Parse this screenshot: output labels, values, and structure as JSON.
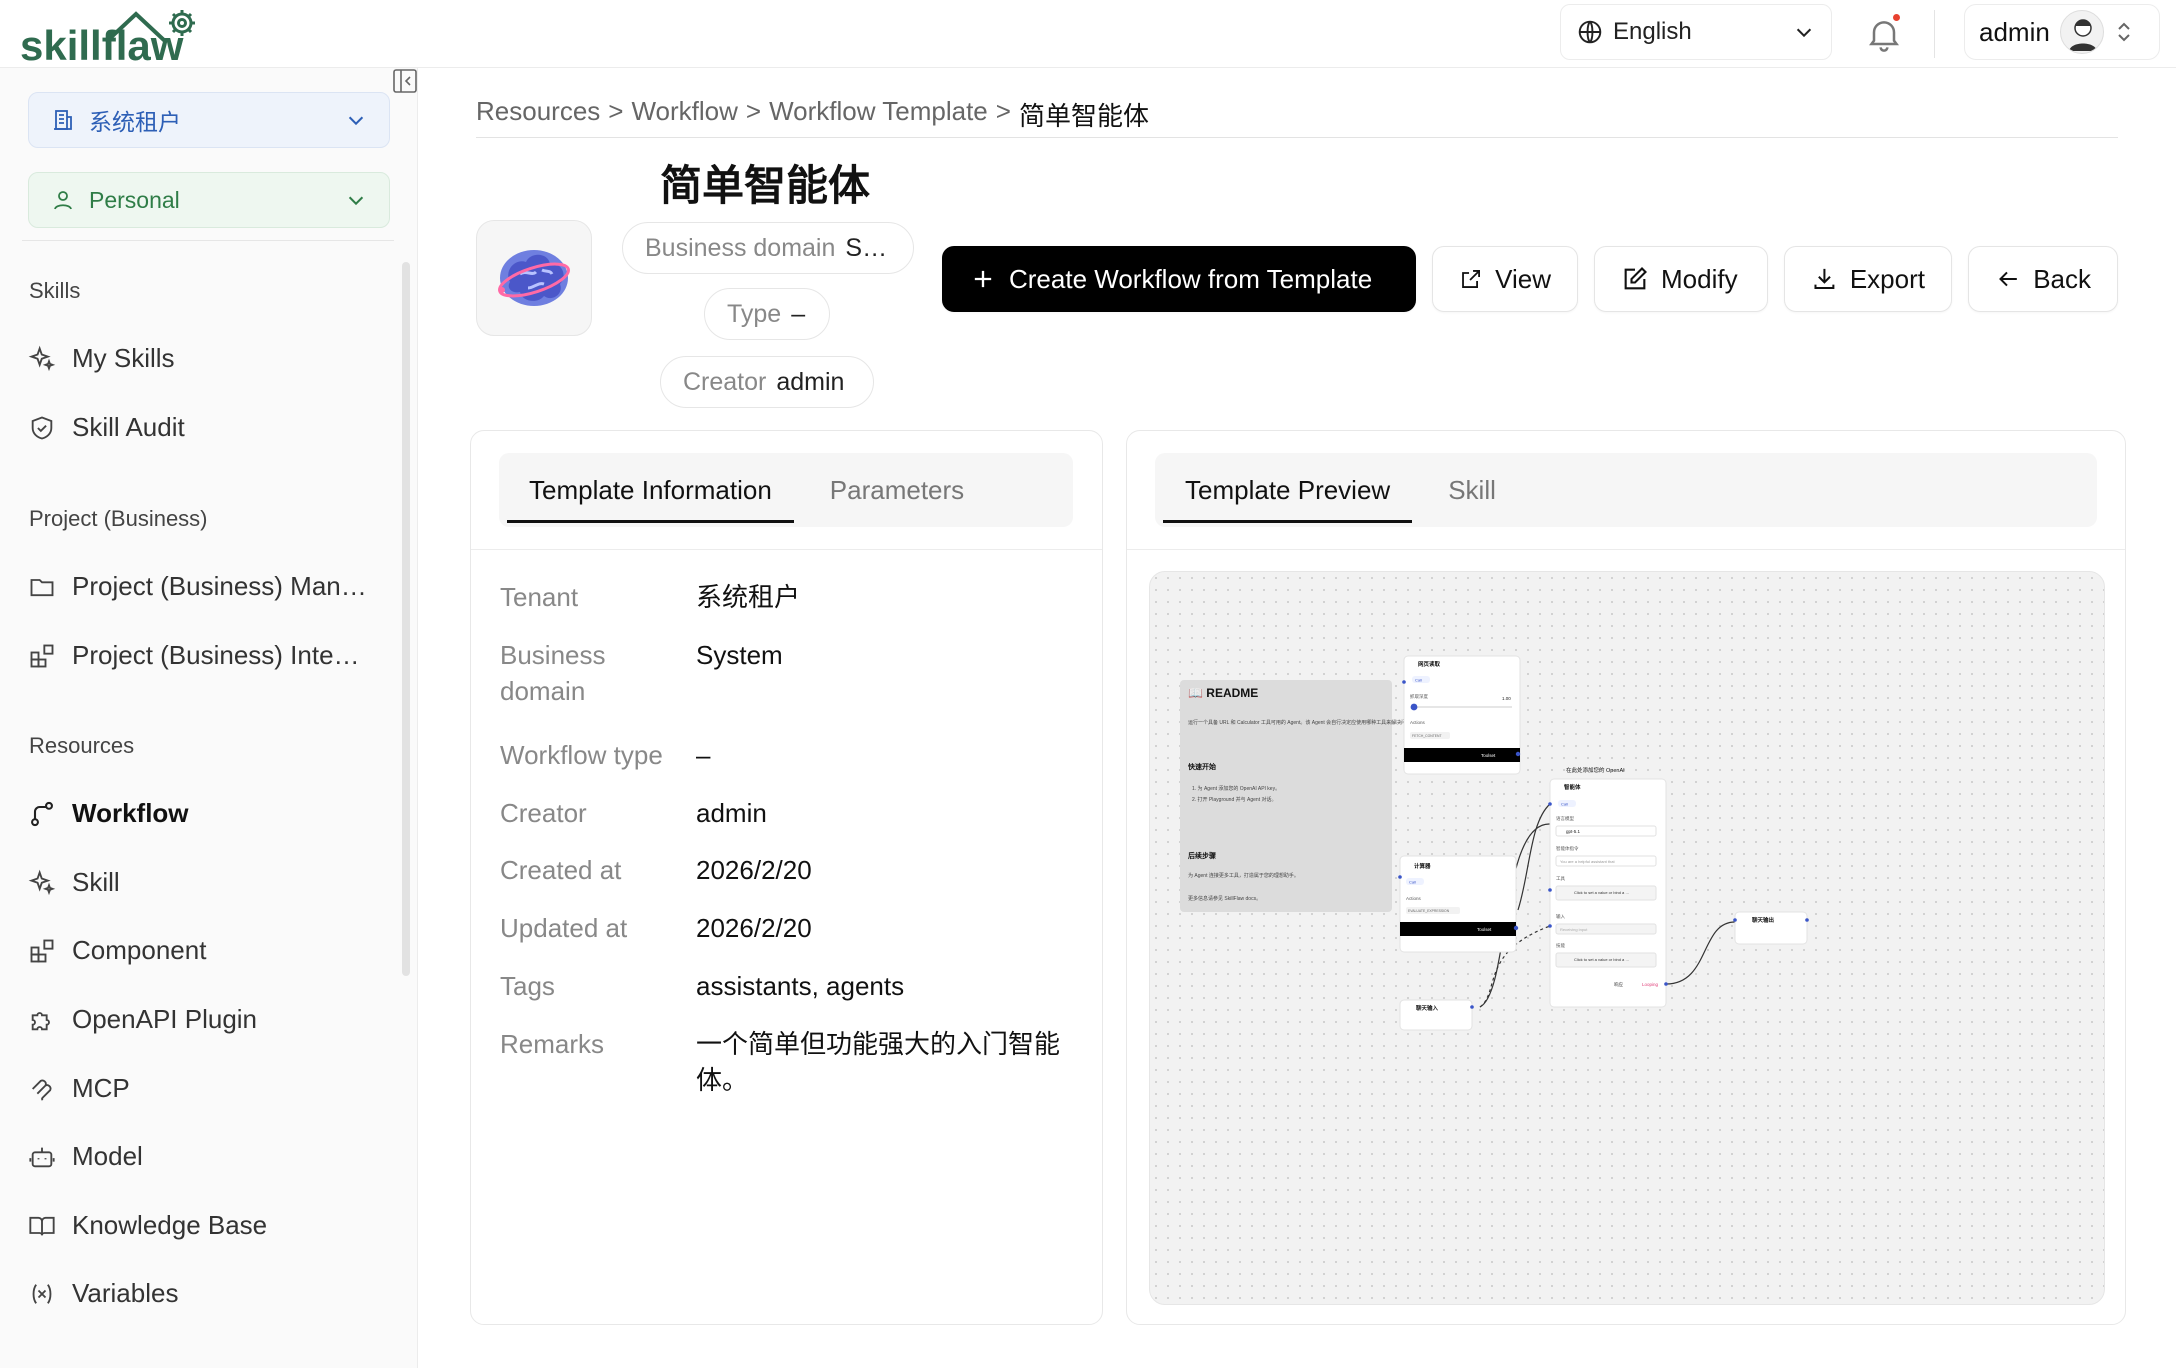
{
  "app": {
    "logo_text": "skillflaw"
  },
  "header": {
    "language": "English",
    "user": "admin"
  },
  "sidebar": {
    "tenant_select": "系统租户",
    "space_select": "Personal",
    "sections": {
      "skills": "Skills",
      "project": "Project (Business)",
      "resources": "Resources"
    },
    "items": {
      "my_skills": "My Skills",
      "skill_audit": "Skill Audit",
      "project_manage": "Project (Business) Man…",
      "project_integration": "Project (Business) Inte…",
      "workflow": "Workflow",
      "skill": "Skill",
      "component": "Component",
      "openapi_plugin": "OpenAPI Plugin",
      "mcp": "MCP",
      "model": "Model",
      "knowledge_base": "Knowledge Base",
      "variables": "Variables"
    }
  },
  "breadcrumb": {
    "items": [
      "Resources",
      "Workflow",
      "Workflow Template"
    ],
    "separator": ">",
    "current": "简单智能体"
  },
  "template": {
    "title": "简单智能体",
    "chips": {
      "business_domain_label": "Business domain",
      "business_domain_value": "S…",
      "type_label": "Type",
      "type_value": "–",
      "creator_label": "Creator",
      "creator_value": "admin"
    }
  },
  "actions": {
    "create": "Create Workflow from Template",
    "view": "View",
    "modify": "Modify",
    "export": "Export",
    "back": "Back"
  },
  "info_card": {
    "tabs": [
      "Template Information",
      "Parameters"
    ],
    "rows": [
      {
        "k": "Tenant",
        "v": "系统租户"
      },
      {
        "k": "Business domain",
        "v": "System"
      },
      {
        "k": "Workflow type",
        "v": "–"
      },
      {
        "k": "Creator",
        "v": "admin"
      },
      {
        "k": "Created at",
        "v": "2026/2/20"
      },
      {
        "k": "Updated at",
        "v": "2026/2/20"
      },
      {
        "k": "Tags",
        "v": "assistants, agents"
      },
      {
        "k": "Remarks",
        "v": "一个简单但功能强大的入门智能体。"
      }
    ]
  },
  "preview_card": {
    "tabs": [
      "Template Preview",
      "Skill"
    ],
    "canvas": {
      "readme": {
        "title": "📖 README",
        "intro": "运行一个具备 URL 和 Calculator 工具可用的 Agent。该 Agent 会自行决定应使用哪种工具来解决问题。",
        "quick_start": "快速开始",
        "steps": [
          "1. 为 Agent 添加您的 OpenAI API key。",
          "2. 打开 Playground 并与 Agent 对话。"
        ],
        "next": "后续步骤",
        "next_text": "为 Agent 连接更多工具，打造属于您的理想助手。",
        "docs": "更多信息请参见 SkillFlaw docs。"
      },
      "nodes": {
        "fetch": {
          "title": "网页读取",
          "call": "Call",
          "depth_label": "抓取深度",
          "depth_value": "1.00",
          "actions": "Actions",
          "action_value": "FETCH_CONTENT",
          "toolset": "Toolset"
        },
        "calc": {
          "title": "计算器",
          "call": "Call",
          "actions": "Actions",
          "action_value": "EVALUATE_EXPRESSION",
          "toolset": "Toolset"
        },
        "agent": {
          "hint": "在此处添加您的 OpenAI",
          "title": "智能体",
          "call": "Call",
          "model_label": "语言模型",
          "model_value": "gpt-5.1",
          "instr_label": "智能体指令",
          "instr_value": "You are a helpful assistant that",
          "tools_label": "工具",
          "tools_btn": "Click to set a value or bind a …",
          "input_label": "输入",
          "input_ph": "Receiving input",
          "skills_label": "技能",
          "skills_btn": "Click to set a value or bind a …",
          "response": "响应",
          "looping": "Looping"
        },
        "chat_in": {
          "title": "聊天输入"
        },
        "chat_out": {
          "title": "聊天输出"
        }
      }
    }
  },
  "colors": {
    "accent": "#000000",
    "tenant_blue": "#2d5fb6",
    "personal_green": "#2f7d47",
    "notify_dot": "#e8412f"
  }
}
